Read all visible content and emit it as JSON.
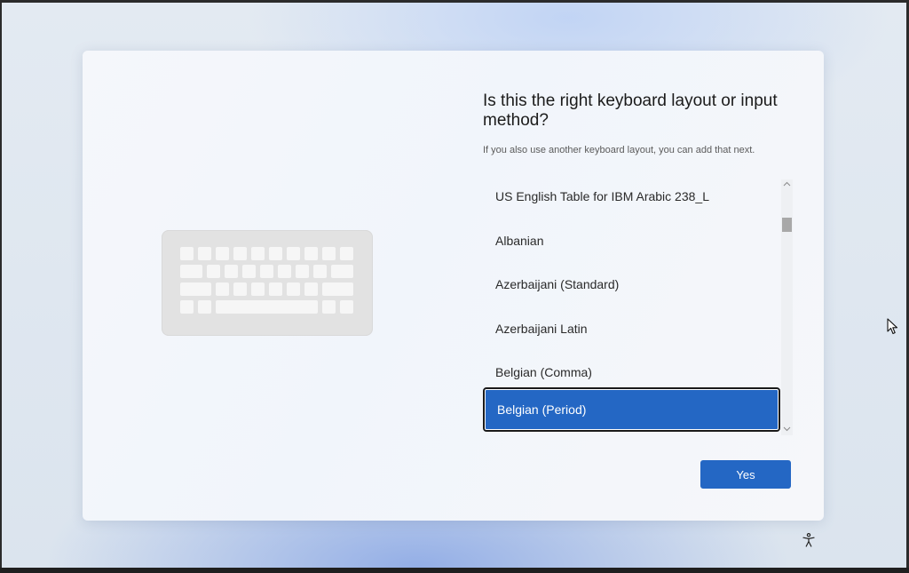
{
  "dialog": {
    "title": "Is this the right keyboard layout or input method?",
    "subtitle": "If you also use another keyboard layout, you can add that next."
  },
  "layouts": {
    "items": [
      {
        "label": "US English Table for IBM Arabic 238_L"
      },
      {
        "label": "Albanian"
      },
      {
        "label": "Azerbaijani (Standard)"
      },
      {
        "label": "Azerbaijani Latin"
      },
      {
        "label": "Belgian (Comma)"
      },
      {
        "label": "Belgian (Period)",
        "selected": true
      }
    ],
    "scroll_up_icon": "chevron-up-icon",
    "scroll_down_icon": "chevron-down-icon"
  },
  "actions": {
    "yes_label": "Yes"
  },
  "icons": {
    "illustration": "keyboard-icon",
    "accessibility": "accessibility-icon",
    "pointer": "mouse-pointer-icon"
  },
  "colors": {
    "accent": "#2467c4",
    "selected_border": "#1a1a1a"
  }
}
